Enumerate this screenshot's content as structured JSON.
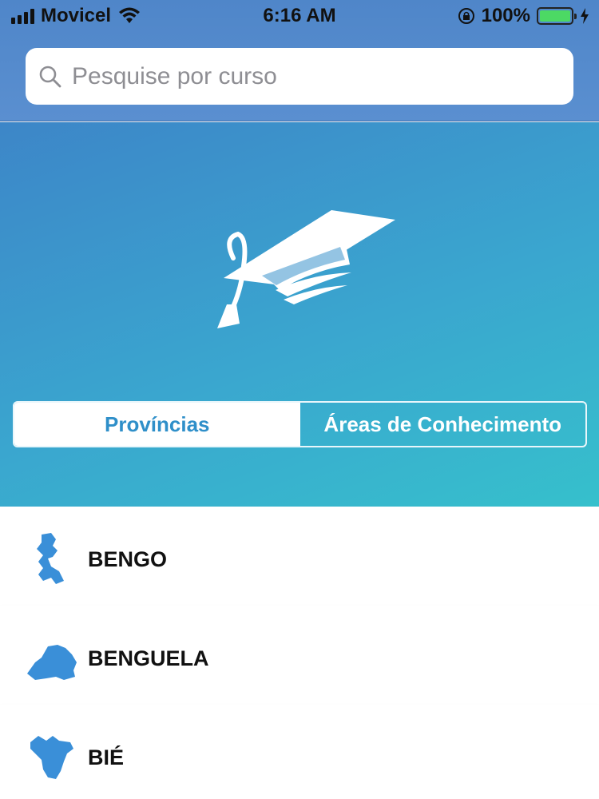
{
  "status_bar": {
    "carrier": "Movicel",
    "time": "6:16 AM",
    "battery": "100%"
  },
  "search": {
    "placeholder": "Pesquise por curso"
  },
  "segmented_control": {
    "options": [
      "Províncias",
      "Áreas de Conhecimento"
    ],
    "selected": "Províncias"
  },
  "provinces": [
    {
      "name": "BENGO"
    },
    {
      "name": "BENGUELA"
    },
    {
      "name": "BIÉ"
    }
  ],
  "colors": {
    "accent": "#2f8fc9",
    "map_icon": "#3a8fd8",
    "header": "#4f86c9"
  },
  "icons": {
    "hero": "graduation-cap-icon",
    "search": "search-icon"
  }
}
